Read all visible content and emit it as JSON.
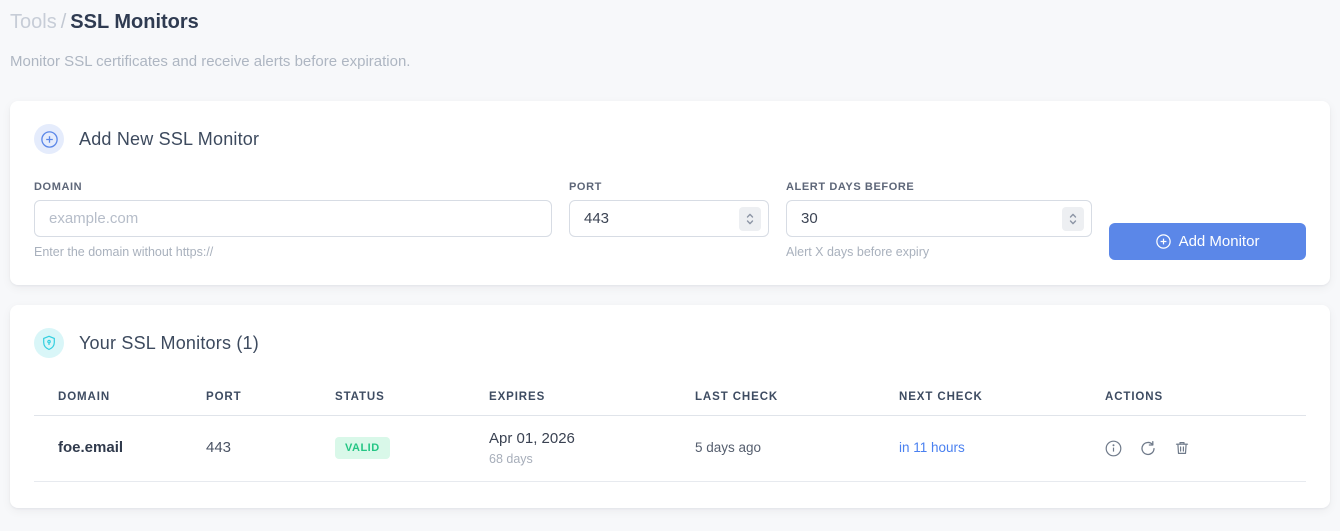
{
  "page": {
    "breadcrumb": {
      "section": "Tools",
      "separator": "/",
      "current": "SSL Monitors"
    },
    "subtitle": "Monitor SSL certificates and receive alerts before expiration."
  },
  "add_monitor": {
    "title": "Add New SSL Monitor",
    "fields": {
      "domain": {
        "label": "DOMAIN",
        "placeholder": "example.com",
        "helper": "Enter the domain without https://"
      },
      "port": {
        "label": "PORT",
        "value": "443"
      },
      "alert_days": {
        "label": "ALERT DAYS BEFORE",
        "value": "30",
        "helper": "Alert X days before expiry"
      }
    },
    "submit_label": "Add Monitor"
  },
  "monitors": {
    "title": "Your SSL Monitors (1)",
    "table": {
      "headers": [
        "DOMAIN",
        "PORT",
        "STATUS",
        "EXPIRES",
        "LAST CHECK",
        "NEXT CHECK",
        "ACTIONS"
      ],
      "rows": [
        {
          "domain": "foe.email",
          "port": "443",
          "status": "VALID",
          "expires_date": "Apr 01, 2026",
          "expires_days": "68 days",
          "last_check": "5 days ago",
          "next_check": "in 11 hours"
        }
      ]
    }
  },
  "icons": {
    "add_header": "plus-circle-icon",
    "list_header": "shield-icon",
    "button": "plus-circle-icon",
    "row_actions": [
      "info-icon",
      "refresh-icon",
      "trash-icon"
    ]
  },
  "colors": {
    "accent_blue": "#5b87e8",
    "valid_badge_bg": "#d9f8e9",
    "valid_badge_text": "#25c685",
    "next_check_blue": "#4a80f0",
    "shield_cyan": "#33cfe0",
    "page_bg": "#f7f8fa"
  }
}
